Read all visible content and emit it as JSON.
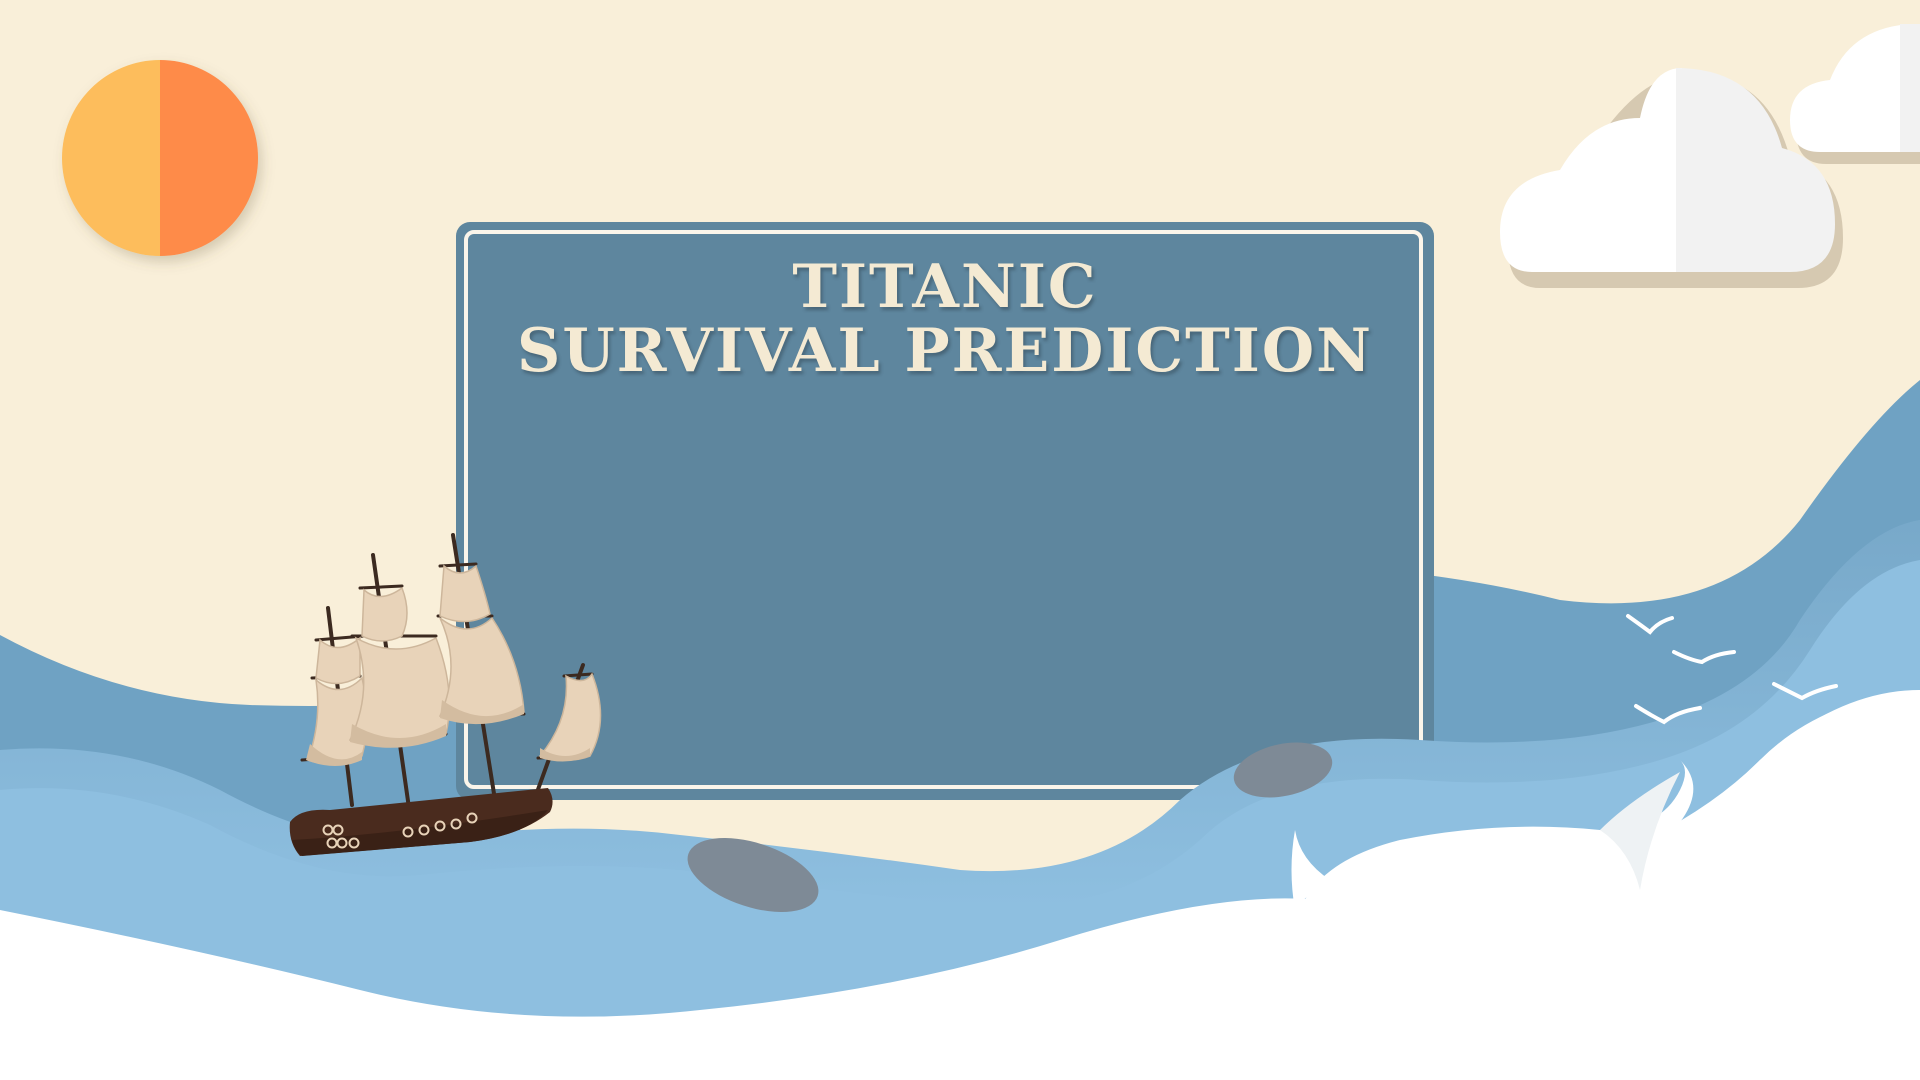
{
  "slide": {
    "title_line_1": "TITANIC",
    "title_line_2": "SURVIVAL PREDICTION"
  },
  "icons": [
    "sun-icon",
    "cloud-icon",
    "ship-icon",
    "bird-icon",
    "whale-icon"
  ],
  "colors": {
    "sky": "#f9efd9",
    "panel": "#5e869e",
    "panel_border": "#fbf5ea",
    "title_text": "#f4ead3",
    "wave_dark": "#6fa2c3",
    "wave_light": "#8ebfe0",
    "foam": "#ffffff",
    "sun_left": "#fdbd5c",
    "sun_right": "#fe8b48",
    "hull": "#4a2b1e",
    "sail": "#e8d3b9"
  }
}
